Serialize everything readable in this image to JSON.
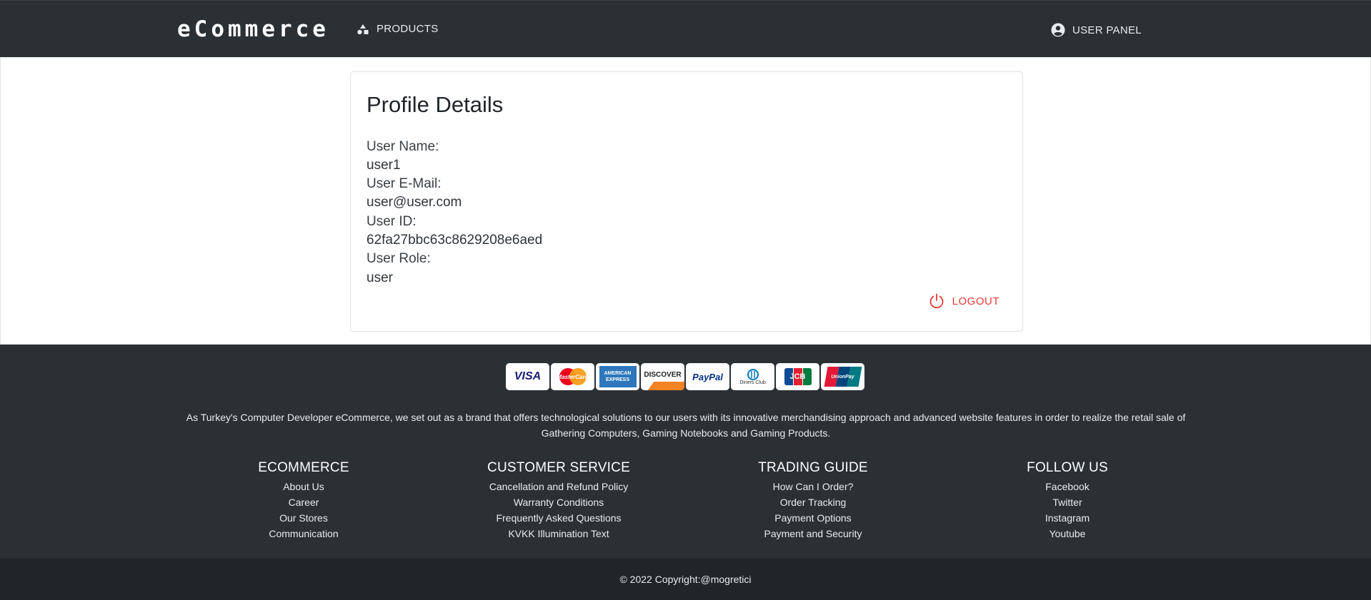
{
  "navbar": {
    "brand": "eCommerce",
    "products_label": "PRODUCTS",
    "products_icon": "shapes-icon",
    "user_panel_label": "USER PANEL",
    "user_panel_icon": "account-circle-icon"
  },
  "profile": {
    "title": "Profile Details",
    "fields": [
      {
        "label": "User Name:",
        "value": "user1"
      },
      {
        "label": "User E-Mail:",
        "value": "user@user.com"
      },
      {
        "label": "User ID:",
        "value": "62fa27bbc63c8629208e6aed"
      },
      {
        "label": "User Role:",
        "value": "user"
      }
    ],
    "logout_label": "LOGOUT",
    "logout_icon": "power-icon",
    "logout_color": "#e53935"
  },
  "footer": {
    "payment_methods": [
      {
        "name": "VISA",
        "icon": "visa-icon"
      },
      {
        "name": "MasterCard",
        "icon": "mastercard-icon"
      },
      {
        "name": "AMERICAN EXPRESS",
        "icon": "amex-icon"
      },
      {
        "name": "DISCOVER",
        "icon": "discover-icon"
      },
      {
        "name": "PayPal",
        "icon": "paypal-icon"
      },
      {
        "name": "Diners Club",
        "icon": "diners-club-icon"
      },
      {
        "name": "JCB",
        "icon": "jcb-icon"
      },
      {
        "name": "UnionPay",
        "icon": "unionpay-icon"
      }
    ],
    "about_text": "As Turkey's Computer Developer eCommerce, we set out as a brand that offers technological solutions to our users with its innovative merchandising approach and advanced website features in order to realize the retail sale of Gathering Computers, Gaming Notebooks and Gaming Products.",
    "columns": [
      {
        "title": "ECOMMERCE",
        "links": [
          "About Us",
          "Career",
          "Our Stores",
          "Communication"
        ]
      },
      {
        "title": "CUSTOMER SERVICE",
        "links": [
          "Cancellation and Refund Policy",
          "Warranty Conditions",
          "Frequently Asked Questions",
          "KVKK Illumination Text"
        ]
      },
      {
        "title": "TRADING GUIDE",
        "links": [
          "How Can I Order?",
          "Order Tracking",
          "Payment Options",
          "Payment and Security"
        ]
      },
      {
        "title": "FOLLOW US",
        "links": [
          "Facebook",
          "Twitter",
          "Instagram",
          "Youtube"
        ]
      }
    ],
    "copyright": "© 2022 Copyright:@mogretici"
  },
  "colors": {
    "navbar_bg": "#2b3035",
    "footer_bg": "#2b3035",
    "copyright_bg": "#212529"
  }
}
